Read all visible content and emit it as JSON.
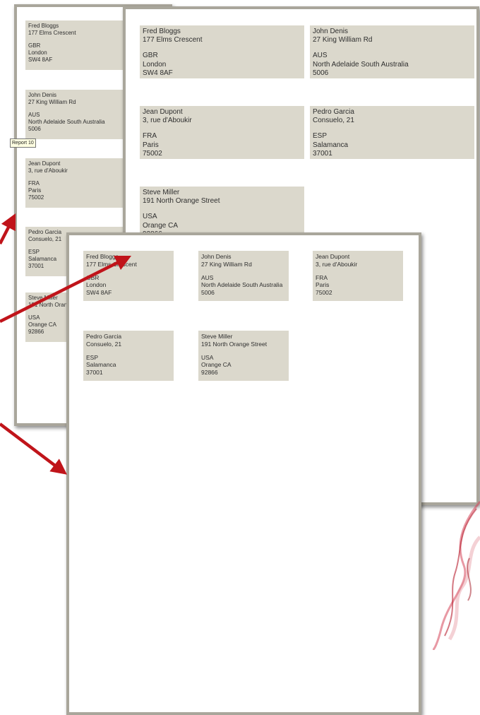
{
  "colors": {
    "label_bg": "#dbd8cc",
    "page_border": "#a9a69b",
    "arrow": "#c0141a"
  },
  "tooltip_text": "Report 10",
  "addresses": [
    {
      "name": "Fred Bloggs",
      "street": "177 Elms Crescent",
      "country": "GBR",
      "city": "London",
      "postcode": "SW4 8AF"
    },
    {
      "name": "John Denis",
      "street": "27 King William Rd",
      "country": "AUS",
      "city": "North Adelaide South Australia",
      "postcode": "5006"
    },
    {
      "name": "Jean Dupont",
      "street": "3, rue d'Aboukir",
      "country": "FRA",
      "city": "Paris",
      "postcode": "75002"
    },
    {
      "name": "Pedro Garcia",
      "street": "Consuelo, 21",
      "country": "ESP",
      "city": "Salamanca",
      "postcode": "37001"
    },
    {
      "name": "Steve Miller",
      "street": "191 North Orange Street",
      "country": "USA",
      "city": "Orange CA",
      "postcode": "92866"
    }
  ]
}
